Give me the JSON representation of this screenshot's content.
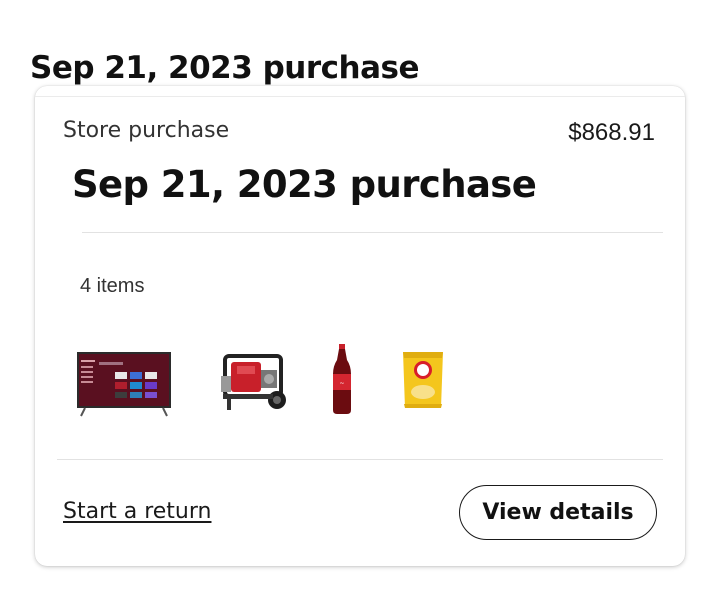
{
  "page": {
    "heading": "Sep 21, 2023 purchase"
  },
  "order_card": {
    "store_label": "Store purchase",
    "total": "$868.91",
    "title": "Sep 21, 2023 purchase",
    "item_count": "4 items",
    "items": [
      {
        "icon": "tv-thumbnail"
      },
      {
        "icon": "generator-thumbnail"
      },
      {
        "icon": "soda-bottle-thumbnail"
      },
      {
        "icon": "chips-bag-thumbnail"
      }
    ],
    "return_link": "Start a return",
    "details_button": "View details"
  },
  "colors": {
    "text": "#1a1a1a",
    "divider": "#e2e2e2",
    "card_background": "#ffffff"
  }
}
